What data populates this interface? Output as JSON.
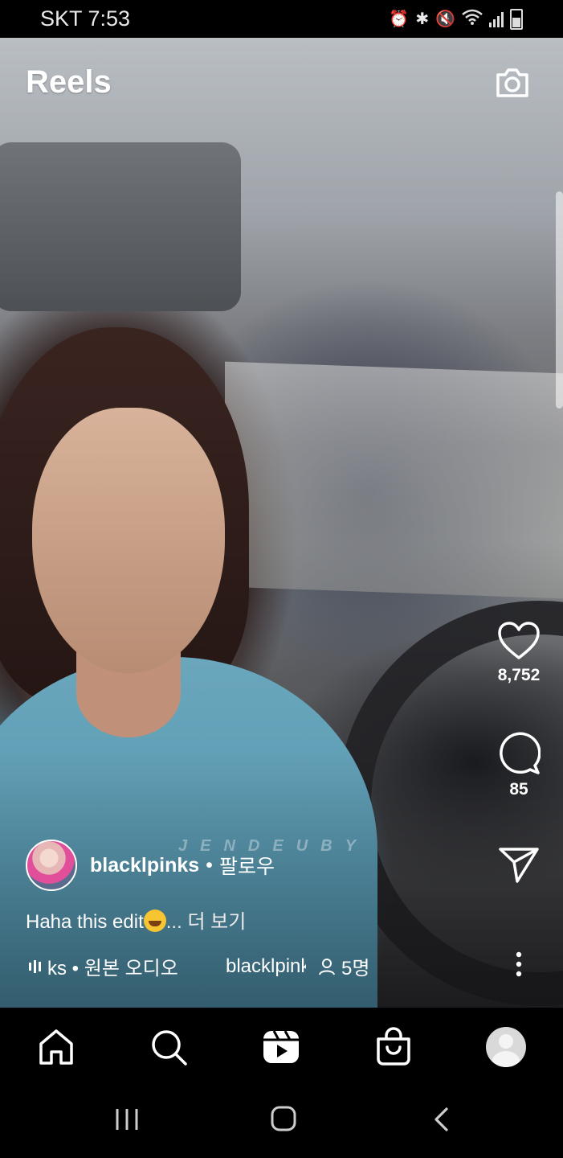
{
  "status_bar": {
    "carrier_time": "SKT 7:53",
    "icons": [
      "alarm-icon",
      "bluetooth-icon",
      "mute-icon",
      "wifi-icon",
      "signal-icon",
      "battery-icon"
    ]
  },
  "header": {
    "title": "Reels",
    "camera_icon": "camera-icon"
  },
  "video": {
    "watermark": "JENDEUBY"
  },
  "actions": {
    "likes": "8,752",
    "comments": "85",
    "like_icon": "heart-icon",
    "comment_icon": "comment-icon",
    "share_icon": "share-icon",
    "more_icon": "more-vertical-icon"
  },
  "post": {
    "username": "blacklpinks",
    "separator": "•",
    "follow_label": "팔로우",
    "caption_text": "Haha this edit",
    "caption_more": "... 더 보기",
    "audio_text": "ks • 원본 오디오",
    "audio_user": "blacklpinks",
    "tagged_people": "5명"
  },
  "bottom_nav": [
    "home-icon",
    "search-icon",
    "reels-icon",
    "shop-icon",
    "profile-avatar"
  ],
  "system_nav": [
    "recent-apps-icon",
    "home-button-icon",
    "back-icon"
  ]
}
